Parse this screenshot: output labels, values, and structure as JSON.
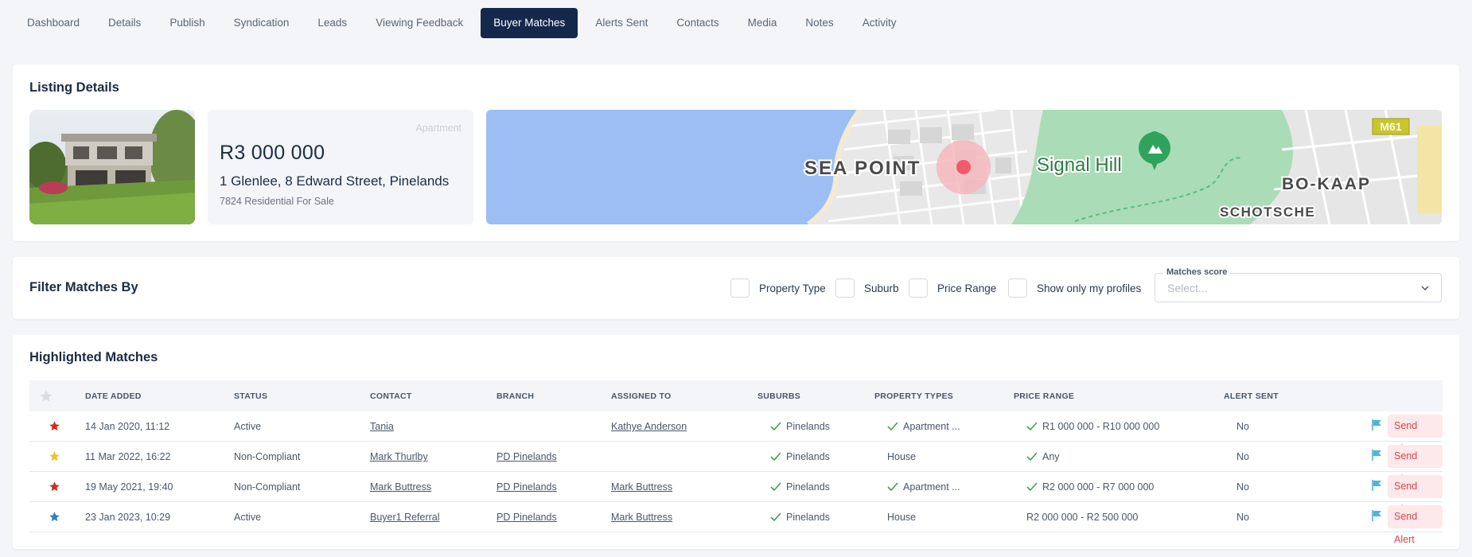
{
  "tabs": [
    {
      "label": "Dashboard"
    },
    {
      "label": "Details"
    },
    {
      "label": "Publish"
    },
    {
      "label": "Syndication"
    },
    {
      "label": "Leads"
    },
    {
      "label": "Viewing Feedback"
    },
    {
      "label": "Buyer Matches",
      "active": true
    },
    {
      "label": "Alerts Sent"
    },
    {
      "label": "Contacts"
    },
    {
      "label": "Media"
    },
    {
      "label": "Notes"
    },
    {
      "label": "Activity"
    }
  ],
  "listing": {
    "title": "Listing Details",
    "type": "Apartment",
    "price": "R3 000 000",
    "address": "1 Glenlee, 8 Edward Street, Pinelands",
    "reference": "7824 Residential For Sale",
    "map_labels": {
      "sea_point": "SEA POINT",
      "signal_hill": "Signal Hill",
      "bo_kaap": "BO-KAAP",
      "schotsche": "SCHOTSCHE",
      "road": "M61"
    }
  },
  "filter": {
    "title": "Filter Matches By",
    "options": [
      "Property Type",
      "Suburb",
      "Price Range",
      "Show only my profiles"
    ],
    "score_label": "Matches score",
    "score_placeholder": "Select..."
  },
  "matches": {
    "title": "Highlighted Matches",
    "columns": [
      "DATE ADDED",
      "STATUS",
      "CONTACT",
      "BRANCH",
      "ASSIGNED TO",
      "SUBURBS",
      "PROPERTY TYPES",
      "PRICE RANGE",
      "ALERT SENT"
    ],
    "send_label": "Send Alert",
    "rows": [
      {
        "star": "red",
        "date": "14 Jan 2020, 11:12",
        "status": "Active",
        "contact": "Tania",
        "branch": "",
        "assigned": "Kathye Anderson",
        "suburb": "Pinelands",
        "suburb_ok": true,
        "ptype": "Apartment ...",
        "ptype_ok": true,
        "price": "R1 000 000 - R10 000 000",
        "price_ok": true,
        "alert": "No"
      },
      {
        "star": "yellow",
        "date": "11 Mar 2022, 16:22",
        "status": "Non-Compliant",
        "contact": "Mark Thurlby",
        "branch": "PD Pinelands",
        "assigned": "",
        "suburb": "Pinelands",
        "suburb_ok": true,
        "ptype": "House",
        "ptype_ok": false,
        "price": "Any",
        "price_ok": true,
        "alert": "No"
      },
      {
        "star": "red",
        "date": "19 May 2021, 19:40",
        "status": "Non-Compliant",
        "contact": "Mark Buttress",
        "branch": "PD Pinelands",
        "assigned": "Mark Buttress",
        "suburb": "Pinelands",
        "suburb_ok": true,
        "ptype": "Apartment ...",
        "ptype_ok": true,
        "price": "R2 000 000 - R7 000 000",
        "price_ok": true,
        "alert": "No"
      },
      {
        "star": "blue",
        "date": "23 Jan 2023, 10:29",
        "status": "Active",
        "contact": "Buyer1 Referral",
        "branch": "PD Pinelands",
        "assigned": "Mark Buttress",
        "suburb": "Pinelands",
        "suburb_ok": true,
        "ptype": "House",
        "ptype_ok": false,
        "price": "R2 000 000 - R2 500 000",
        "price_ok": false,
        "alert": "No"
      }
    ]
  },
  "colors": {
    "active_tab": "#13284a",
    "star_red": "#d42a1e",
    "star_yellow": "#f2c12e",
    "star_blue": "#2e7fc6",
    "tick_green": "#3fa34d",
    "flag_blue": "#4fb3d9",
    "send_bg": "#fde8ea",
    "send_text": "#e0424e"
  }
}
